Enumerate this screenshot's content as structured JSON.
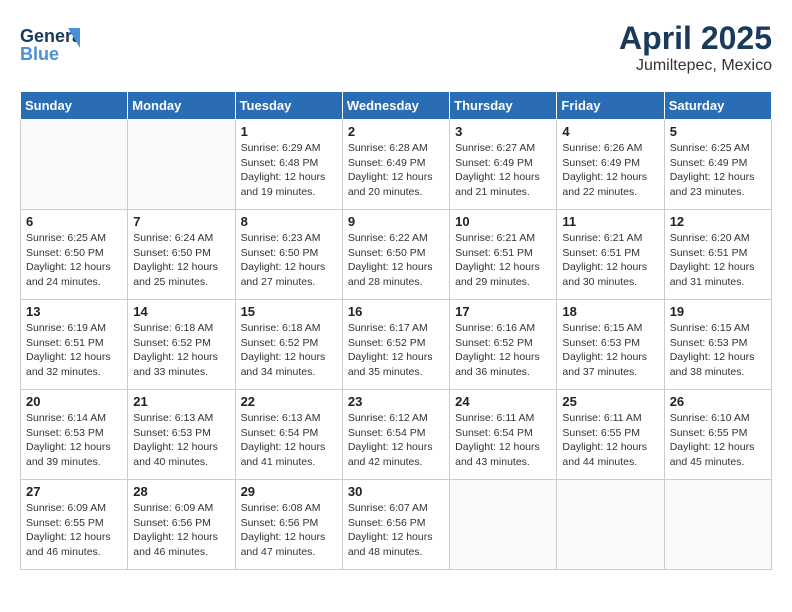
{
  "header": {
    "logo_general": "General",
    "logo_blue": "Blue",
    "title": "April 2025",
    "subtitle": "Jumiltepec, Mexico"
  },
  "weekdays": [
    "Sunday",
    "Monday",
    "Tuesday",
    "Wednesday",
    "Thursday",
    "Friday",
    "Saturday"
  ],
  "weeks": [
    [
      null,
      null,
      {
        "day": "1",
        "sunrise": "Sunrise: 6:29 AM",
        "sunset": "Sunset: 6:48 PM",
        "daylight": "Daylight: 12 hours and 19 minutes."
      },
      {
        "day": "2",
        "sunrise": "Sunrise: 6:28 AM",
        "sunset": "Sunset: 6:49 PM",
        "daylight": "Daylight: 12 hours and 20 minutes."
      },
      {
        "day": "3",
        "sunrise": "Sunrise: 6:27 AM",
        "sunset": "Sunset: 6:49 PM",
        "daylight": "Daylight: 12 hours and 21 minutes."
      },
      {
        "day": "4",
        "sunrise": "Sunrise: 6:26 AM",
        "sunset": "Sunset: 6:49 PM",
        "daylight": "Daylight: 12 hours and 22 minutes."
      },
      {
        "day": "5",
        "sunrise": "Sunrise: 6:25 AM",
        "sunset": "Sunset: 6:49 PM",
        "daylight": "Daylight: 12 hours and 23 minutes."
      }
    ],
    [
      {
        "day": "6",
        "sunrise": "Sunrise: 6:25 AM",
        "sunset": "Sunset: 6:50 PM",
        "daylight": "Daylight: 12 hours and 24 minutes."
      },
      {
        "day": "7",
        "sunrise": "Sunrise: 6:24 AM",
        "sunset": "Sunset: 6:50 PM",
        "daylight": "Daylight: 12 hours and 25 minutes."
      },
      {
        "day": "8",
        "sunrise": "Sunrise: 6:23 AM",
        "sunset": "Sunset: 6:50 PM",
        "daylight": "Daylight: 12 hours and 27 minutes."
      },
      {
        "day": "9",
        "sunrise": "Sunrise: 6:22 AM",
        "sunset": "Sunset: 6:50 PM",
        "daylight": "Daylight: 12 hours and 28 minutes."
      },
      {
        "day": "10",
        "sunrise": "Sunrise: 6:21 AM",
        "sunset": "Sunset: 6:51 PM",
        "daylight": "Daylight: 12 hours and 29 minutes."
      },
      {
        "day": "11",
        "sunrise": "Sunrise: 6:21 AM",
        "sunset": "Sunset: 6:51 PM",
        "daylight": "Daylight: 12 hours and 30 minutes."
      },
      {
        "day": "12",
        "sunrise": "Sunrise: 6:20 AM",
        "sunset": "Sunset: 6:51 PM",
        "daylight": "Daylight: 12 hours and 31 minutes."
      }
    ],
    [
      {
        "day": "13",
        "sunrise": "Sunrise: 6:19 AM",
        "sunset": "Sunset: 6:51 PM",
        "daylight": "Daylight: 12 hours and 32 minutes."
      },
      {
        "day": "14",
        "sunrise": "Sunrise: 6:18 AM",
        "sunset": "Sunset: 6:52 PM",
        "daylight": "Daylight: 12 hours and 33 minutes."
      },
      {
        "day": "15",
        "sunrise": "Sunrise: 6:18 AM",
        "sunset": "Sunset: 6:52 PM",
        "daylight": "Daylight: 12 hours and 34 minutes."
      },
      {
        "day": "16",
        "sunrise": "Sunrise: 6:17 AM",
        "sunset": "Sunset: 6:52 PM",
        "daylight": "Daylight: 12 hours and 35 minutes."
      },
      {
        "day": "17",
        "sunrise": "Sunrise: 6:16 AM",
        "sunset": "Sunset: 6:52 PM",
        "daylight": "Daylight: 12 hours and 36 minutes."
      },
      {
        "day": "18",
        "sunrise": "Sunrise: 6:15 AM",
        "sunset": "Sunset: 6:53 PM",
        "daylight": "Daylight: 12 hours and 37 minutes."
      },
      {
        "day": "19",
        "sunrise": "Sunrise: 6:15 AM",
        "sunset": "Sunset: 6:53 PM",
        "daylight": "Daylight: 12 hours and 38 minutes."
      }
    ],
    [
      {
        "day": "20",
        "sunrise": "Sunrise: 6:14 AM",
        "sunset": "Sunset: 6:53 PM",
        "daylight": "Daylight: 12 hours and 39 minutes."
      },
      {
        "day": "21",
        "sunrise": "Sunrise: 6:13 AM",
        "sunset": "Sunset: 6:53 PM",
        "daylight": "Daylight: 12 hours and 40 minutes."
      },
      {
        "day": "22",
        "sunrise": "Sunrise: 6:13 AM",
        "sunset": "Sunset: 6:54 PM",
        "daylight": "Daylight: 12 hours and 41 minutes."
      },
      {
        "day": "23",
        "sunrise": "Sunrise: 6:12 AM",
        "sunset": "Sunset: 6:54 PM",
        "daylight": "Daylight: 12 hours and 42 minutes."
      },
      {
        "day": "24",
        "sunrise": "Sunrise: 6:11 AM",
        "sunset": "Sunset: 6:54 PM",
        "daylight": "Daylight: 12 hours and 43 minutes."
      },
      {
        "day": "25",
        "sunrise": "Sunrise: 6:11 AM",
        "sunset": "Sunset: 6:55 PM",
        "daylight": "Daylight: 12 hours and 44 minutes."
      },
      {
        "day": "26",
        "sunrise": "Sunrise: 6:10 AM",
        "sunset": "Sunset: 6:55 PM",
        "daylight": "Daylight: 12 hours and 45 minutes."
      }
    ],
    [
      {
        "day": "27",
        "sunrise": "Sunrise: 6:09 AM",
        "sunset": "Sunset: 6:55 PM",
        "daylight": "Daylight: 12 hours and 46 minutes."
      },
      {
        "day": "28",
        "sunrise": "Sunrise: 6:09 AM",
        "sunset": "Sunset: 6:56 PM",
        "daylight": "Daylight: 12 hours and 46 minutes."
      },
      {
        "day": "29",
        "sunrise": "Sunrise: 6:08 AM",
        "sunset": "Sunset: 6:56 PM",
        "daylight": "Daylight: 12 hours and 47 minutes."
      },
      {
        "day": "30",
        "sunrise": "Sunrise: 6:07 AM",
        "sunset": "Sunset: 6:56 PM",
        "daylight": "Daylight: 12 hours and 48 minutes."
      },
      null,
      null,
      null
    ]
  ]
}
